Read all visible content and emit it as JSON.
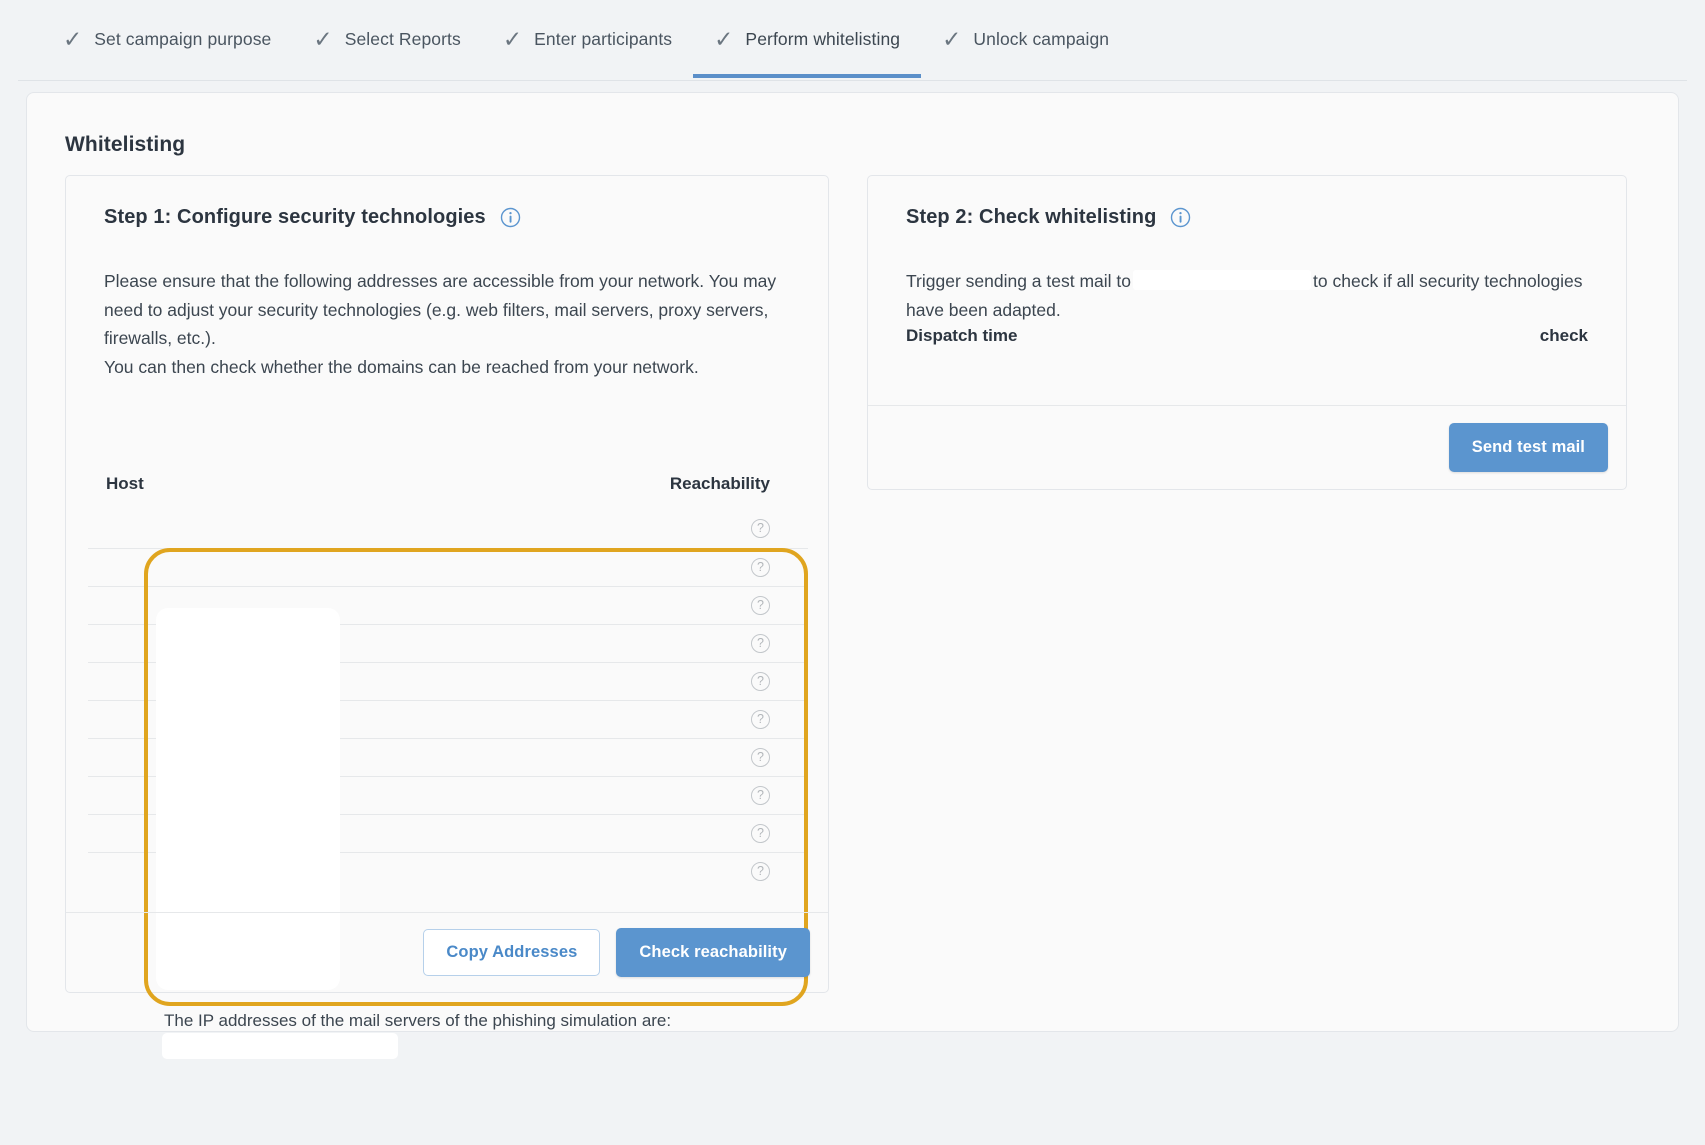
{
  "wizard": {
    "steps": [
      {
        "label": "Set campaign purpose",
        "icon": "check-icon",
        "active": false
      },
      {
        "label": "Select Reports",
        "icon": "check-icon",
        "active": false
      },
      {
        "label": "Enter participants",
        "icon": "check-icon",
        "active": false
      },
      {
        "label": "Perform whitelisting",
        "icon": "check-icon",
        "active": true
      },
      {
        "label": "Unlock campaign",
        "icon": "check-icon",
        "active": false
      }
    ],
    "check_glyph": "✓",
    "active_indicator_color": "#5b8fc9"
  },
  "page": {
    "title": "Whitelisting"
  },
  "step1": {
    "heading": "Step 1: Configure security technologies",
    "info_icon": "info-circle-icon",
    "paragraph_line1": "Please ensure that the following addresses are accessible from your network. You may need to adjust your security technologies (e.g. web filters, mail servers, proxy servers, firewalls, etc.).",
    "paragraph_line2": "You can then check whether the domains can be reached from your network.",
    "table": {
      "columns": [
        "Host",
        "Reachability"
      ],
      "reachability_glyph": "?",
      "rows": [
        {
          "host": "",
          "reachability": "unknown"
        },
        {
          "host": "",
          "reachability": "unknown"
        },
        {
          "host": "",
          "reachability": "unknown"
        },
        {
          "host": "",
          "reachability": "unknown"
        },
        {
          "host": "",
          "reachability": "unknown"
        },
        {
          "host": "",
          "reachability": "unknown"
        },
        {
          "host": "",
          "reachability": "unknown"
        },
        {
          "host": "",
          "reachability": "unknown"
        },
        {
          "host": "",
          "reachability": "unknown"
        },
        {
          "host": "",
          "reachability": "unknown"
        }
      ]
    },
    "highlight_color": "#e0a51f",
    "ip_note": "The IP addresses of the mail servers of the phishing simulation are:",
    "ip_value": "",
    "copy_button": "Copy Addresses",
    "check_button": "Check reachability"
  },
  "step2": {
    "heading": "Step 2: Check whitelisting",
    "info_icon": "info-circle-icon",
    "text_before": "Trigger sending a test mail to",
    "redacted_recipient": "",
    "text_after": "to check if all security technologies have been adapted.",
    "table": {
      "columns": [
        "Dispatch time",
        "check"
      ],
      "rows": []
    },
    "send_button": "Send test mail"
  },
  "colors": {
    "accent_blue": "#5b95cf",
    "highlight_yellow": "#e0a51f",
    "page_bg": "#f1f3f5",
    "card_bg": "#fafafa",
    "text": "#3c4650"
  }
}
